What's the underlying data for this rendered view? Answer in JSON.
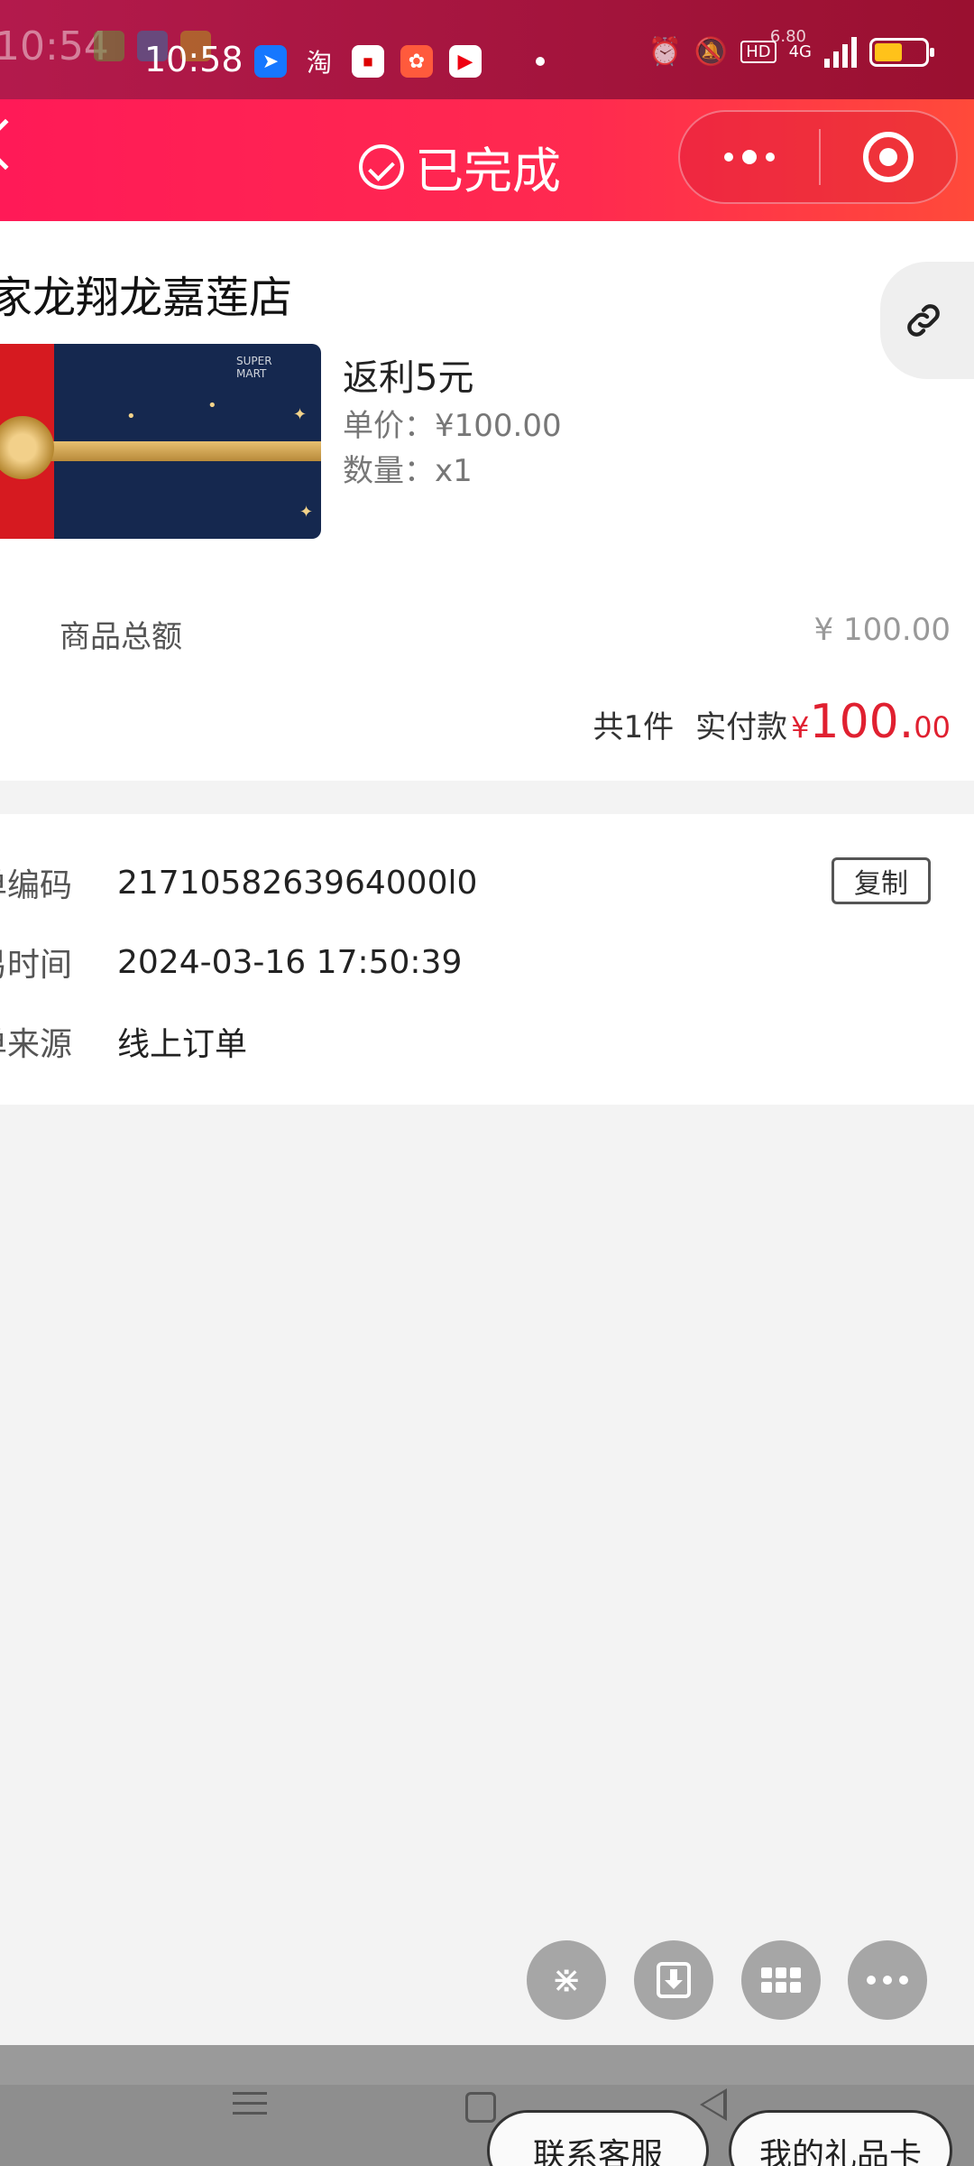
{
  "status_bar": {
    "ghost_time": "10:54",
    "time": "10:58",
    "app_taobao": "淘",
    "speed": "6.80",
    "hd": "HD",
    "network": "4G"
  },
  "header": {
    "title": "已完成"
  },
  "store": {
    "name": "家龙翔龙嘉莲店"
  },
  "product": {
    "title": "返利5元",
    "unit_price": "单价：¥100.00",
    "quantity": "数量：x1",
    "image_logo": "SUPER MART"
  },
  "summary": {
    "goods_total_label": "商品总额",
    "goods_total_value": "¥ 100.00",
    "count_text": "共1件",
    "paid_label": "实付款",
    "paid_currency": "¥",
    "paid_integer": "100.",
    "paid_decimal": "00"
  },
  "order_info": {
    "rows": [
      {
        "label": "单编码",
        "value": "2171058263964000l0"
      },
      {
        "label": "易时间",
        "value": "2024-03-16 17:50:39"
      },
      {
        "label": "单来源",
        "value": "线上订单"
      }
    ],
    "copy_label": "复制"
  },
  "bottom_buttons": {
    "service": "联系客服",
    "gift_card": "我的礼品卡"
  },
  "colors": {
    "accent": "#ff1a57",
    "price_red": "#e02030"
  }
}
